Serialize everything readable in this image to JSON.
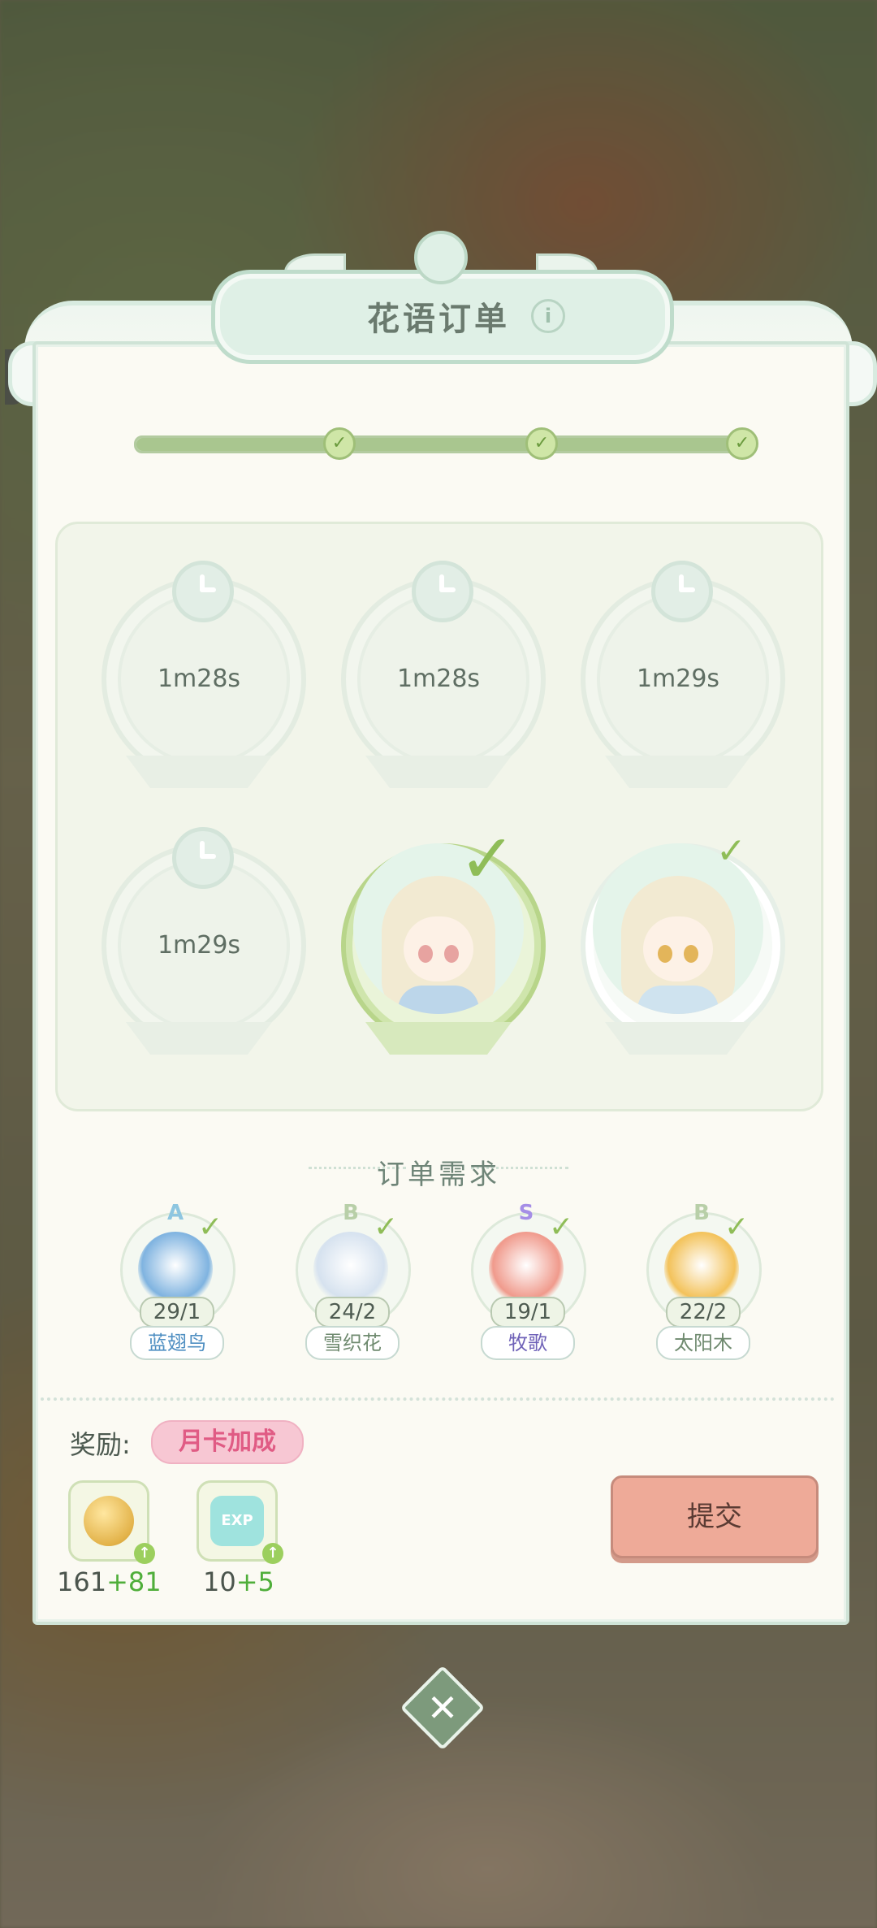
{
  "dialog": {
    "title": "花语订单",
    "info_icon": "i"
  },
  "progress": {
    "fraction": 1.0,
    "milestones": [
      "✓",
      "✓",
      "✓"
    ]
  },
  "orders": [
    {
      "state": "cooldown",
      "timer": "1m28s"
    },
    {
      "state": "cooldown",
      "timer": "1m28s"
    },
    {
      "state": "cooldown",
      "timer": "1m29s"
    },
    {
      "state": "cooldown",
      "timer": "1m29s"
    },
    {
      "state": "selected-complete",
      "check": "✓"
    },
    {
      "state": "complete",
      "check": "✓"
    }
  ],
  "requirements": {
    "label": "订单需求",
    "items": [
      {
        "grade": "A",
        "grade_color": "#8ec6e0",
        "count": "29/1",
        "name": "蓝翅鸟",
        "name_color": "#4f8fc2",
        "plant_color": "#7fb3e0",
        "check": "✓"
      },
      {
        "grade": "B",
        "grade_color": "#b8cfa8",
        "count": "24/2",
        "name": "雪织花",
        "name_color": "#6f8a6f",
        "plant_color": "#d6e2ef",
        "check": "✓"
      },
      {
        "grade": "S",
        "grade_color": "#a58ee6",
        "count": "19/1",
        "name": "牧歌",
        "name_color": "#6f62b8",
        "plant_color": "#f09a8c",
        "check": "✓"
      },
      {
        "grade": "B",
        "grade_color": "#b8cfa8",
        "count": "22/2",
        "name": "太阳木",
        "name_color": "#6f8a6f",
        "plant_color": "#f3c25a",
        "check": "✓"
      }
    ]
  },
  "rewards": {
    "label": "奖励:",
    "month_card": "月卡加成",
    "items": [
      {
        "icon": "coin-icon",
        "base": "161",
        "bonus": "+81"
      },
      {
        "icon": "exp-icon",
        "icon_text": "EXP",
        "base": "10",
        "bonus": "+5"
      }
    ]
  },
  "submit_label": "提交",
  "close_label": "✕",
  "colors": {
    "accent_green": "#8fbd58",
    "submit": "#eeaa98",
    "month_card": "#f7c7d3"
  }
}
